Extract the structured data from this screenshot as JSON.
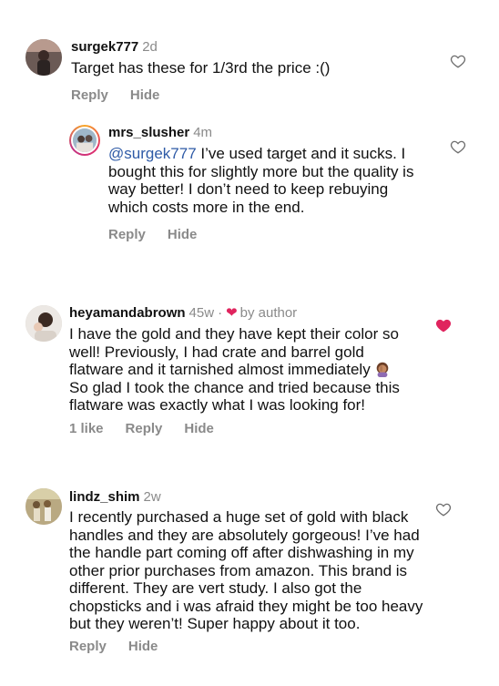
{
  "comments": [
    {
      "username": "surgek777",
      "time": "2d",
      "text": "Target has these for 1/3rd the price :()",
      "actions": {
        "reply": "Reply",
        "hide": "Hide"
      },
      "liked": false
    },
    {
      "username": "mrs_slusher",
      "time": "4m",
      "mention": "@surgek777",
      "text": " I’ve used target and it sucks. I bought this for slightly more but the quality is way better! I don’t need to keep rebuying which costs more in the end.",
      "actions": {
        "reply": "Reply",
        "hide": "Hide"
      },
      "liked": false
    },
    {
      "username": "heyamandabrown",
      "time": "45w",
      "separator": "·",
      "author_badge": "by author",
      "text": "I have the gold and they have kept their color so well! Previously, I had crate and barrel gold flatware and it tarnished almost immediately",
      "text2": "So glad I took the chance and tried because this flatware was exactly what I was looking for!",
      "actions": {
        "likes": "1 like",
        "reply": "Reply",
        "hide": "Hide"
      },
      "liked": true,
      "like_color": "#e0245e"
    },
    {
      "username": "lindz_shim",
      "time": "2w",
      "text": "I recently purchased a huge set of gold with black handles and they are absolutely gorgeous! I’ve had the handle part coming off after dishwashing in my other prior purchases from amazon. This brand is different. They are vert study. I also got the chopsticks and i was afraid they might be too heavy but they weren’t! Super happy about it too.",
      "actions": {
        "reply": "Reply",
        "hide": "Hide"
      },
      "liked": false
    }
  ]
}
